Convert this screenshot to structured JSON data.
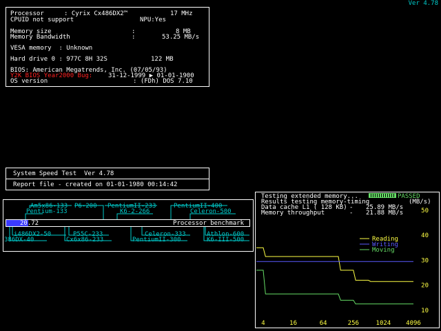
{
  "version": "Ver 4.78",
  "sysinfo": {
    "processor_label": "Processor",
    "processor_value": ": Cyrix Cx486DX2™",
    "processor_freq": "17 MHz",
    "cpuid": "CPUID not support",
    "npu": "NPU:Yes",
    "memsize_label": "Memory size",
    "memsize_value": "8 MB",
    "membw_label": "Memory Bandwidth",
    "membw_value": "53.25 MB/s",
    "colon": ":",
    "vesa": "VESA memory  : Unknown",
    "hdd_label": "Hard drive 0 : 977C 8H 32S",
    "hdd_size": "122 MB",
    "bios": "BIOS: American Megatrends, Inc. (07/05/93)",
    "y2k_label": "Y2K BIOS Year2000 Bug:",
    "y2k_value": "31-12-1999 ▶ 01-01-1900",
    "os_label": "OS version",
    "os_value": ": (FDh) DOS 7.10"
  },
  "speedtest": {
    "title": "System Speed Test  Ver 4.78",
    "report": "Report file - created on 01-01-1980 00:14:42"
  },
  "benchmark": {
    "score": "20.72",
    "score_fraction": 0.09,
    "label": "Processor benchmark",
    "top_refs": [
      {
        "label": "Am5x86-133"
      },
      {
        "label": "P6-200"
      },
      {
        "label": "Pentium-133"
      },
      {
        "label": "PentiumII-233"
      },
      {
        "label": "K6-2-266"
      },
      {
        "label": "PentiumII-400"
      },
      {
        "label": "Celeron-500"
      }
    ],
    "bottom_refs": [
      {
        "label": "i486DX2-50"
      },
      {
        "label": "386DX-40"
      },
      {
        "label": "P55C-233"
      },
      {
        "label": "Cx6x86-233"
      },
      {
        "label": "Celeron-333"
      },
      {
        "label": "PentiumII-300"
      },
      {
        "label": "Athlon-600"
      },
      {
        "label": "K6-III-500"
      }
    ]
  },
  "memtest": {
    "testing": "Testing extended memory...",
    "passed": "PASSED",
    "results": "Results testing memory-timing",
    "units": "(MB/s)",
    "cache_label": "Data cache L1 ( 128 KB)",
    "cache_dash": "-",
    "cache_value": "25.89 MB/s",
    "throughput_label": "Memory throughput",
    "throughput_dash": "-",
    "throughput_value": "21.88 MB/s"
  },
  "chart_data": {
    "type": "line",
    "x_labels": [
      "4",
      "16",
      "64",
      "256",
      "1024",
      "4096"
    ],
    "y_labels": [
      "10",
      "20",
      "30",
      "40",
      "50"
    ],
    "ylim": [
      5,
      50
    ],
    "x": [
      4,
      8,
      16,
      32,
      64,
      128,
      256,
      512,
      1024,
      2048,
      4096
    ],
    "legend_placement": "center-right",
    "series": [
      {
        "name": "Reading",
        "color": "#ffff44",
        "values": [
          35,
          31.5,
          31.5,
          31.5,
          31.5,
          31.5,
          26,
          22,
          21.5,
          21.5,
          21.5
        ]
      },
      {
        "name": "Writing",
        "color": "#5b5bff",
        "values": [
          29.5,
          29.5,
          29.5,
          29.5,
          29.5,
          29.5,
          29.5,
          29.5,
          29.5,
          29.5,
          29.5
        ]
      },
      {
        "name": "Moving",
        "color": "#66dd66",
        "values": [
          26,
          16.5,
          16.5,
          16.5,
          16.5,
          16.5,
          14,
          12.5,
          12.5,
          12.5,
          12.5
        ]
      }
    ]
  }
}
